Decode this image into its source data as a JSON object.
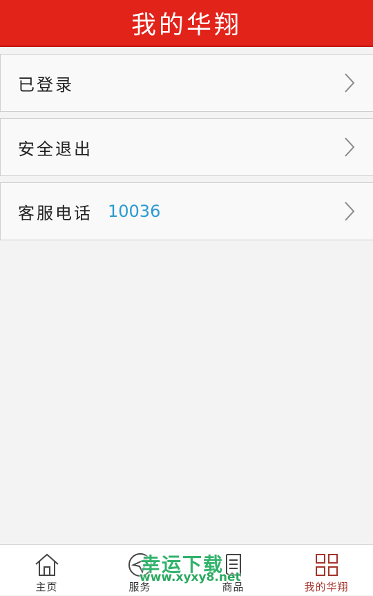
{
  "header": {
    "title": "我的华翔"
  },
  "menu": [
    {
      "label": "已登录",
      "value": ""
    },
    {
      "label": "安全退出",
      "value": ""
    },
    {
      "label": "客服电话",
      "value": "10036"
    }
  ],
  "tabbar": {
    "tabs": [
      {
        "label": "主页",
        "icon": "home-icon"
      },
      {
        "label": "服务",
        "icon": "paper-plane-icon"
      },
      {
        "label": "商品",
        "icon": "receipt-icon"
      },
      {
        "label": "我的华翔",
        "icon": "grid-icon"
      }
    ],
    "active_index": 3
  },
  "watermark": {
    "title": "幸运下载",
    "url": "www.xyxy8.net"
  },
  "colors": {
    "header_red": "#e2231a",
    "phone_blue": "#2a9ad1",
    "active_tab": "#a3342a",
    "watermark_green": "#31b36b"
  }
}
